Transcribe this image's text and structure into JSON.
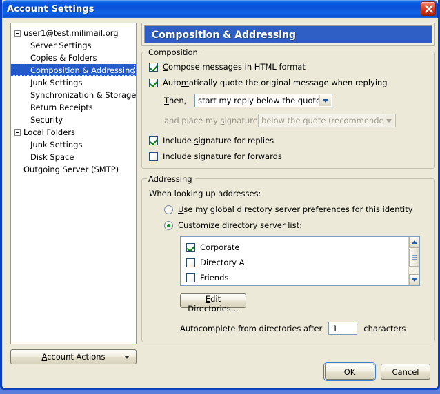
{
  "window": {
    "title": "Account Settings",
    "close_icon": "close-icon"
  },
  "sidebar": {
    "items": [
      {
        "label": "user1@test.milimail.org",
        "level": 0,
        "expander": true
      },
      {
        "label": "Server Settings",
        "level": 1,
        "expander": false
      },
      {
        "label": "Copies & Folders",
        "level": 1,
        "expander": false
      },
      {
        "label": "Composition & Addressing",
        "level": 1,
        "expander": false,
        "selected": true
      },
      {
        "label": "Junk Settings",
        "level": 1,
        "expander": false
      },
      {
        "label": "Synchronization & Storage",
        "level": 1,
        "expander": false
      },
      {
        "label": "Return Receipts",
        "level": 1,
        "expander": false
      },
      {
        "label": "Security",
        "level": 1,
        "expander": false
      },
      {
        "label": "Local Folders",
        "level": 0,
        "expander": true
      },
      {
        "label": "Junk Settings",
        "level": 1,
        "expander": false
      },
      {
        "label": "Disk Space",
        "level": 1,
        "expander": false
      },
      {
        "label": "Outgoing Server (SMTP)",
        "level": 0,
        "expander": false
      }
    ],
    "account_actions": "Account Actions"
  },
  "page": {
    "header": "Composition & Addressing"
  },
  "composition": {
    "group_title": "Composition",
    "html_format": {
      "label": "Compose messages in HTML format",
      "checked": true,
      "accesskey": "C"
    },
    "auto_quote": {
      "label": "Automatically quote the original message when replying",
      "checked": true,
      "accesskey": "m"
    },
    "then_label": "Then,",
    "then_select": {
      "value": "start my reply below the quote",
      "disabled": false
    },
    "signature_label": "and place my signature",
    "signature_select": {
      "value": "below the quote (recommended)",
      "disabled": true
    },
    "sig_replies": {
      "label": "Include signature for replies",
      "checked": true,
      "accesskey": "s"
    },
    "sig_forwards": {
      "label": "Include signature for forwards",
      "checked": false,
      "accesskey": "w"
    }
  },
  "addressing": {
    "group_title": "Addressing",
    "lookup_label": "When looking up addresses:",
    "radio_global": {
      "label": "Use my global directory server preferences for this identity",
      "selected": false
    },
    "radio_custom": {
      "label": "Customize directory server list:",
      "selected": true
    },
    "directories": [
      {
        "label": "Corporate",
        "checked": true
      },
      {
        "label": "Directory A",
        "checked": false
      },
      {
        "label": "Friends",
        "checked": false
      }
    ],
    "edit_directories_button": "Edit Directories...",
    "autocomplete_prefix": "Autocomplete from directories after",
    "autocomplete_value": "1",
    "autocomplete_suffix": "characters"
  },
  "footer": {
    "ok": "OK",
    "cancel": "Cancel"
  },
  "colors": {
    "titlebar_blue": "#0a52d8",
    "header_blue": "#2f5fc4",
    "dialog_bg": "#ece9d8",
    "selection_blue": "#2359c9",
    "check_green": "#0a7a1e",
    "close_red": "#cc2a12"
  }
}
